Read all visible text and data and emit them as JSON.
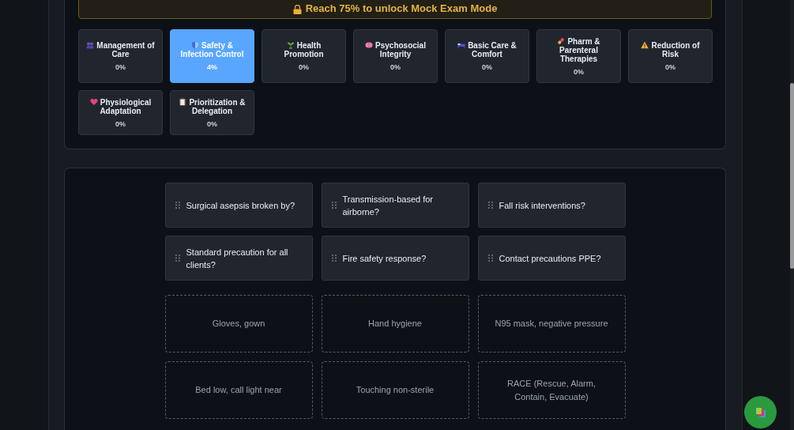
{
  "banner": {
    "text": "Reach 75% to unlock Mock Exam Mode"
  },
  "categories": [
    {
      "label": "Management of Care",
      "percent": "0%",
      "selected": false
    },
    {
      "label": "Safety & Infection Control",
      "percent": "4%",
      "selected": true
    },
    {
      "label": "Health Promotion",
      "percent": "0%",
      "selected": false
    },
    {
      "label": "Psychosocial Integrity",
      "percent": "0%",
      "selected": false
    },
    {
      "label": "Basic Care & Comfort",
      "percent": "0%",
      "selected": false
    },
    {
      "label": "Pharm & Parenteral Therapies",
      "percent": "0%",
      "selected": false
    },
    {
      "label": "Reduction of Risk",
      "percent": "0%",
      "selected": false
    },
    {
      "label": "Physiological Adaptation",
      "percent": "0%",
      "selected": false
    },
    {
      "label": "Prioritization & Delegation",
      "percent": "0%",
      "selected": false
    }
  ],
  "questions": [
    "Surgical asepsis broken by?",
    "Transmission-based for airborne?",
    "Fall risk interventions?",
    "Standard precaution for all clients?",
    "Fire safety response?",
    "Contact precautions PPE?"
  ],
  "answers": [
    "Gloves, gown",
    "Hand hygiene",
    "N95 mask, negative pressure",
    "Bed low, call light near",
    "Touching non-sterile",
    "RACE (Rescue, Alarm, Contain, Evacuate)"
  ]
}
